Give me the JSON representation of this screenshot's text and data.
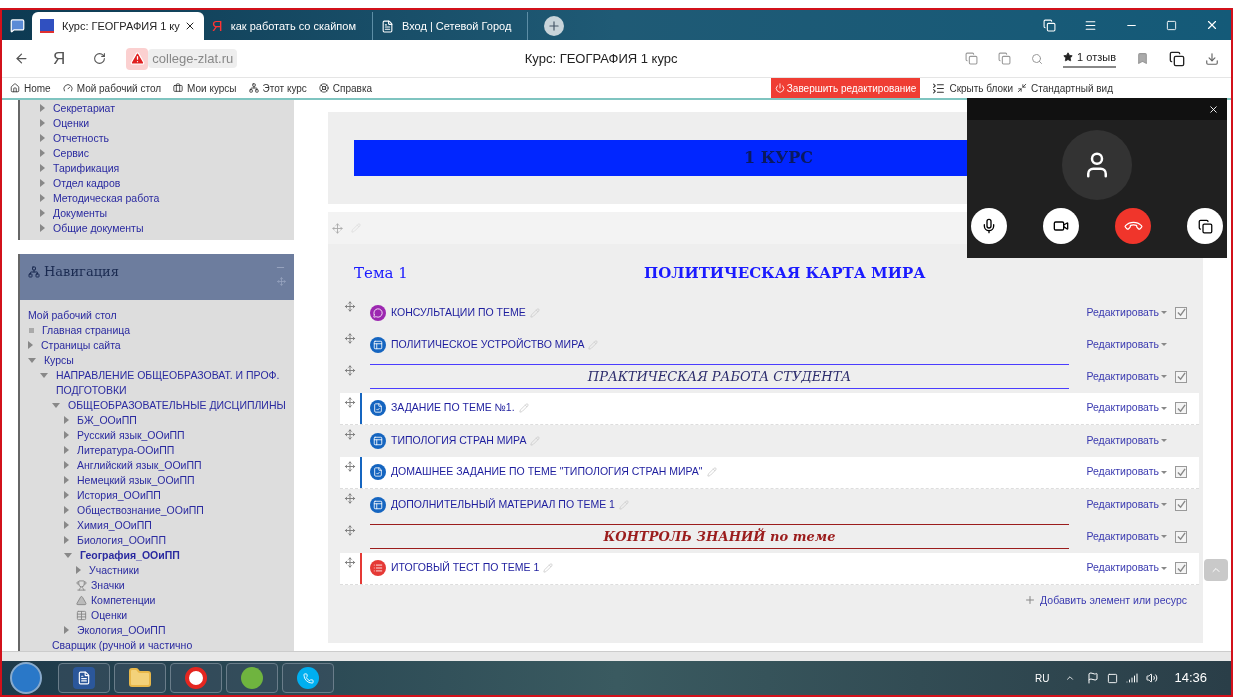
{
  "browser": {
    "tabs": [
      {
        "title": "Курс: ГЕОГРАФИЯ 1 ку",
        "kind": "moodle",
        "selected": true
      },
      {
        "title": "как работать со скайпом",
        "kind": "yandex",
        "glyph": "Я",
        "selected": false
      },
      {
        "title": "Вход | Сетевой Город",
        "kind": "page",
        "selected": false
      }
    ],
    "home_glyph": "Я",
    "address": "college-zlat.ru",
    "page_title": "Курс: ГЕОГРАФИЯ 1 курс",
    "reviews": "1 отзыв"
  },
  "navbar": {
    "links": [
      {
        "label": "Home",
        "kind": "home"
      },
      {
        "label": "Мой рабочий стол",
        "kind": "dashboard"
      },
      {
        "label": "Мои курсы",
        "kind": "briefcase"
      },
      {
        "label": "Этот курс",
        "kind": "sitemap"
      },
      {
        "label": "Справка",
        "kind": "lifebuoy"
      }
    ],
    "finish_editing": "Завершить редактирование",
    "hide_blocks": "Скрыть блоки",
    "standard_view": "Стандартный вид"
  },
  "admin_block": {
    "items": [
      "Секретариат",
      "Оценки",
      "Отчетность",
      "Сервис",
      "Тарификация",
      "Отдел кадров",
      "Методическая работа",
      "Документы",
      "Общие документы"
    ]
  },
  "navigation": {
    "title": "Навигация",
    "tree": [
      {
        "label": "Мой рабочий стол",
        "kind": "plain"
      },
      {
        "label": "Главная страница",
        "kind": "page"
      },
      {
        "label": "Страницы сайта",
        "kind": "branch",
        "expanded": false
      },
      {
        "label": "Курсы",
        "kind": "branch",
        "expanded": true,
        "children": [
          {
            "label": "НАПРАВЛЕНИЕ ОБЩЕОБРАЗОВАТ. И ПРОФ. ПОДГОТОВКИ",
            "kind": "branch",
            "expanded": true,
            "children": [
              {
                "label": "ОБЩЕОБРАЗОВАТЕЛЬНЫЕ ДИСЦИПЛИНЫ",
                "kind": "branch",
                "expanded": true,
                "children": [
                  {
                    "label": "БЖ_ООиПП",
                    "kind": "branch",
                    "expanded": false
                  },
                  {
                    "label": "Русский язык_ООиПП",
                    "kind": "branch",
                    "expanded": false
                  },
                  {
                    "label": "Литература-ООиПП",
                    "kind": "branch",
                    "expanded": false
                  },
                  {
                    "label": "Английский язык_ООиПП",
                    "kind": "branch",
                    "expanded": false
                  },
                  {
                    "label": "Немецкий язык_ООиПП",
                    "kind": "branch",
                    "expanded": false
                  },
                  {
                    "label": "История_ООиПП",
                    "kind": "branch",
                    "expanded": false
                  },
                  {
                    "label": "Обществознание_ООиПП",
                    "kind": "branch",
                    "expanded": false
                  },
                  {
                    "label": "Химия_ООиПП",
                    "kind": "branch",
                    "expanded": false
                  },
                  {
                    "label": "Биология_ООиПП",
                    "kind": "branch",
                    "expanded": false
                  },
                  {
                    "label": "География_ООиПП",
                    "kind": "branch",
                    "expanded": true,
                    "current": true,
                    "children": [
                      {
                        "label": "Участники",
                        "kind": "branch",
                        "expanded": false
                      },
                      {
                        "label": "Значки",
                        "kind": "badges"
                      },
                      {
                        "label": "Компетенции",
                        "kind": "competencies"
                      },
                      {
                        "label": "Оценки",
                        "kind": "grades"
                      }
                    ]
                  },
                  {
                    "label": "Экология_ООиПП",
                    "kind": "branch",
                    "expanded": false
                  }
                ]
              },
              {
                "label": "Сварщик (ручной и частично",
                "kind": "plain"
              }
            ]
          }
        ]
      }
    ]
  },
  "course": {
    "banner": "1 КУРС",
    "section": {
      "name": "Тема 1",
      "title": "ПОЛИТИЧЕСКАЯ КАРТА МИРА",
      "add": "Добавить элемент или ресурс",
      "items": [
        {
          "kind": "chat",
          "color": "#9c27b0",
          "label": "КОНСУЛЬТАЦИИ ПО ТЕМЕ",
          "edit_menu": "Редактировать",
          "highlighted": false,
          "completion": true
        },
        {
          "kind": "page",
          "color": "#1565c0",
          "label": "ПОЛИТИЧЕСКОЕ УСТРОЙСТВО МИРА",
          "edit_menu": "Редактировать",
          "highlighted": false,
          "completion": false
        },
        {
          "kind": "label",
          "color": "#4b3cff",
          "label": "ПРАКТИЧЕСКАЯ РАБОТА СТУДЕНТА",
          "edit_menu": "Редактировать",
          "completion": true
        },
        {
          "kind": "assign",
          "color": "#1565c0",
          "label": "ЗАДАНИЕ ПО ТЕМЕ №1.",
          "edit_menu": "Редактировать",
          "highlighted": true,
          "completion": true
        },
        {
          "kind": "page",
          "color": "#1565c0",
          "label": "ТИПОЛОГИЯ СТРАН МИРА",
          "edit_menu": "Редактировать",
          "highlighted": false,
          "completion": false
        },
        {
          "kind": "assign",
          "color": "#1565c0",
          "label": "ДОМАШНЕЕ ЗАДАНИЕ ПО ТЕМЕ \"ТИПОЛОГИЯ СТРАН МИРА\"",
          "edit_menu": "Редактировать",
          "highlighted": true,
          "completion": true
        },
        {
          "kind": "page",
          "color": "#1565c0",
          "label": "ДОПОЛНИТЕЛЬНЫЙ МАТЕРИАЛ ПО ТЕМЕ 1",
          "edit_menu": "Редактировать",
          "highlighted": false,
          "completion": true
        },
        {
          "kind": "label",
          "color": "#9b1c1c",
          "label": "КОНТРОЛЬ ЗНАНИЙ по теме",
          "edit_menu": "Редактировать",
          "completion": true
        },
        {
          "kind": "quiz",
          "color": "#e53935",
          "label": "ИТОГОВЫЙ ТЕСТ ПО ТЕМЕ 1",
          "edit_menu": "Редактировать",
          "highlighted": true,
          "completion": true
        }
      ]
    }
  },
  "taskbar": {
    "apps": [
      {
        "kind": "word"
      },
      {
        "kind": "folder"
      },
      {
        "kind": "yandex"
      },
      {
        "kind": "torrent"
      },
      {
        "kind": "skype"
      }
    ],
    "language": "RU",
    "time": "14:36"
  }
}
